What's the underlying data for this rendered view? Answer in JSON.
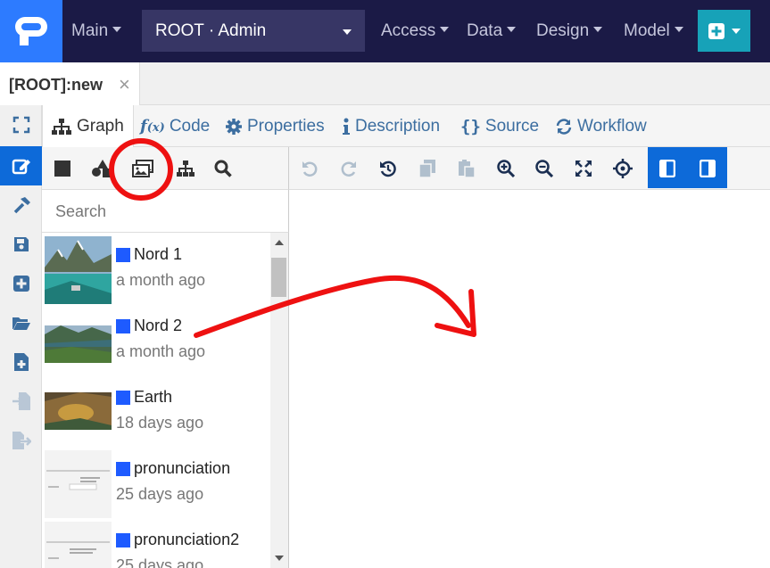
{
  "topbar": {
    "nav": {
      "main": "Main",
      "access": "Access",
      "data": "Data",
      "design": "Design",
      "model": "Model"
    },
    "root_select": "ROOT · Admin"
  },
  "document_tab": {
    "title": "[ROOT]:new",
    "close": "×"
  },
  "editor_tabs": [
    {
      "label": "Graph",
      "icon": "sitemap-icon",
      "active": true
    },
    {
      "label": "Code",
      "icon": "function-icon"
    },
    {
      "label": "Properties",
      "icon": "gear-icon"
    },
    {
      "label": "Description",
      "icon": "info-icon"
    },
    {
      "label": "Source",
      "icon": "braces-icon"
    },
    {
      "label": "Workflow",
      "icon": "sync-icon"
    }
  ],
  "palette": {
    "search_placeholder": "Search",
    "items": [
      {
        "name": "Nord 1",
        "time": "a month ago",
        "thumb": "mountain-lake"
      },
      {
        "name": "Nord 2",
        "time": "a month ago",
        "thumb": "fjord"
      },
      {
        "name": "Earth",
        "time": "18 days ago",
        "thumb": "desert-aerial"
      },
      {
        "name": "pronunciation",
        "time": "25 days ago",
        "thumb": "document-screenshot"
      },
      {
        "name": "pronunciation2",
        "time": "25 days ago",
        "thumb": "document-screenshot"
      }
    ]
  },
  "colors": {
    "navbar": "#1b1a46",
    "logo_bg": "#2d7bff",
    "accent": "#0d6ad9",
    "add_button": "#17a2b8",
    "annotation": "#ee1111",
    "item_marker": "#1e5bff"
  }
}
